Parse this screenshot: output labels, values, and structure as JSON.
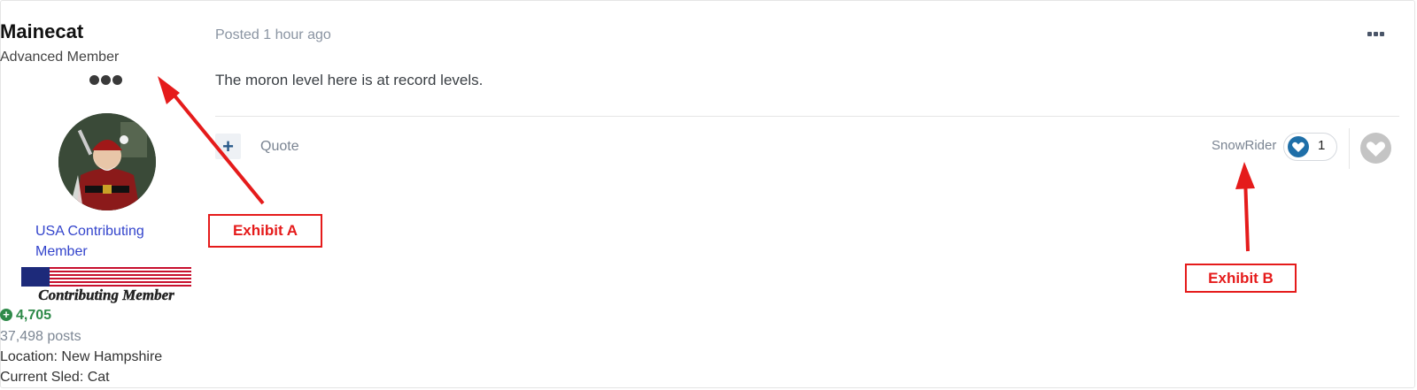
{
  "author": {
    "name": "Mainecat",
    "group": "Advanced Member",
    "title": "USA Contributing Member",
    "badge_text": "Contributing Member",
    "reputation": "4,705",
    "posts": "37,498 posts",
    "location": "Location: New Hampshire",
    "current_sled": "Current Sled: Cat"
  },
  "post": {
    "posted": "Posted 1 hour ago",
    "content": "The moron level here is at record levels.",
    "plus_label": "+",
    "quote_label": "Quote",
    "reaction_user": "SnowRider",
    "reaction_count": "1"
  },
  "annotations": {
    "exhibit_a": "Exhibit A",
    "exhibit_b": "Exhibit B"
  },
  "colors": {
    "annotation": "#e51b1b",
    "link": "#3344cc",
    "reputation": "#2f8a4a"
  }
}
